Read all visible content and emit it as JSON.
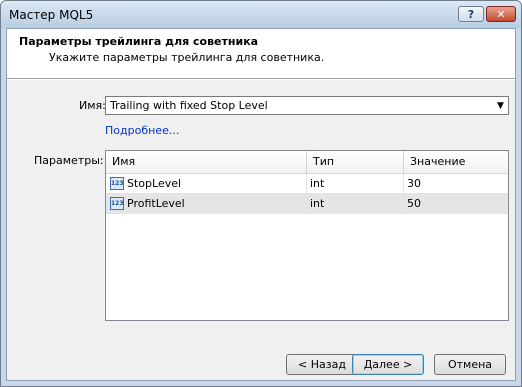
{
  "window": {
    "title": "Мастер MQL5",
    "help_label": "?",
    "close_label": "✕"
  },
  "header": {
    "title": "Параметры трейлинга для советника",
    "subtitle": "Укажите параметры трейлинга для советника."
  },
  "form": {
    "name_label": "Имя:",
    "name_value": "Trailing with fixed Stop Level",
    "more_link": "Подробнее...",
    "params_label": "Параметры:"
  },
  "table": {
    "columns": [
      "Имя",
      "Тип",
      "Значение"
    ],
    "rows": [
      {
        "name": "StopLevel",
        "type": "int",
        "value": "30",
        "icon": "int-param-icon"
      },
      {
        "name": "ProfitLevel",
        "type": "int",
        "value": "50",
        "icon": "int-param-icon"
      }
    ],
    "icon_text": "123"
  },
  "buttons": {
    "back": "< Назад",
    "next": "Далее >",
    "cancel": "Отмена"
  }
}
